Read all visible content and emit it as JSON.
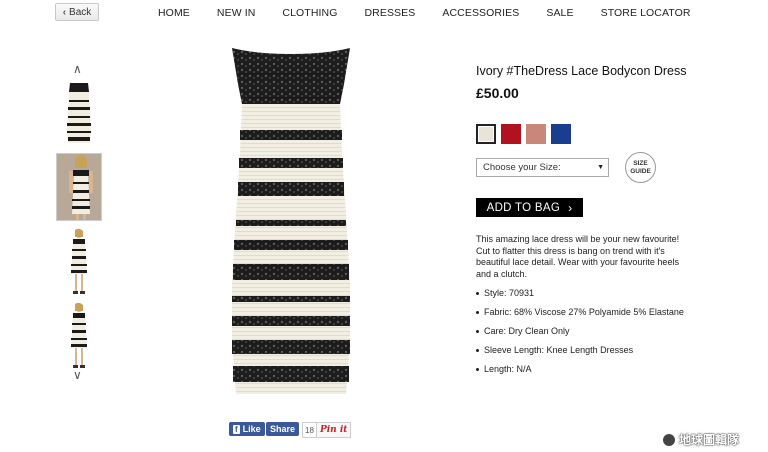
{
  "header": {
    "back_label": "Back",
    "nav": [
      "HOME",
      "NEW IN",
      "CLOTHING",
      "DRESSES",
      "ACCESSORIES",
      "SALE",
      "STORE LOCATOR"
    ]
  },
  "gallery": {
    "up_arrow": "∧",
    "down_arrow": "∨"
  },
  "social": {
    "like_label": "Like",
    "share_label": "Share",
    "pin_count": "18",
    "pin_label": "Pin it"
  },
  "product": {
    "title": "Ivory #TheDress Lace Bodycon Dress",
    "price": "£50.00",
    "swatches": [
      "#e8e4d8",
      "#b0121f",
      "#c9877a",
      "#1b3d8f"
    ],
    "size_placeholder": "Choose your Size:",
    "size_guide_line1": "SIZE",
    "size_guide_line2": "GUIDE",
    "add_to_bag": "ADD TO BAG",
    "description": "This amazing lace dress will be your new favourite! Cut to flatter this dress is bang on trend with it's beautiful lace detail. Wear with your favourite heels and a clutch.",
    "specs": [
      "Style: 70931",
      "Fabric: 68% Viscose 27% Polyamide 5% Elastane",
      "Care: Dry Clean Only",
      "Sleeve Length: Knee Length Dresses",
      "Length: N/A"
    ]
  },
  "watermark": "地球圖輯隊"
}
